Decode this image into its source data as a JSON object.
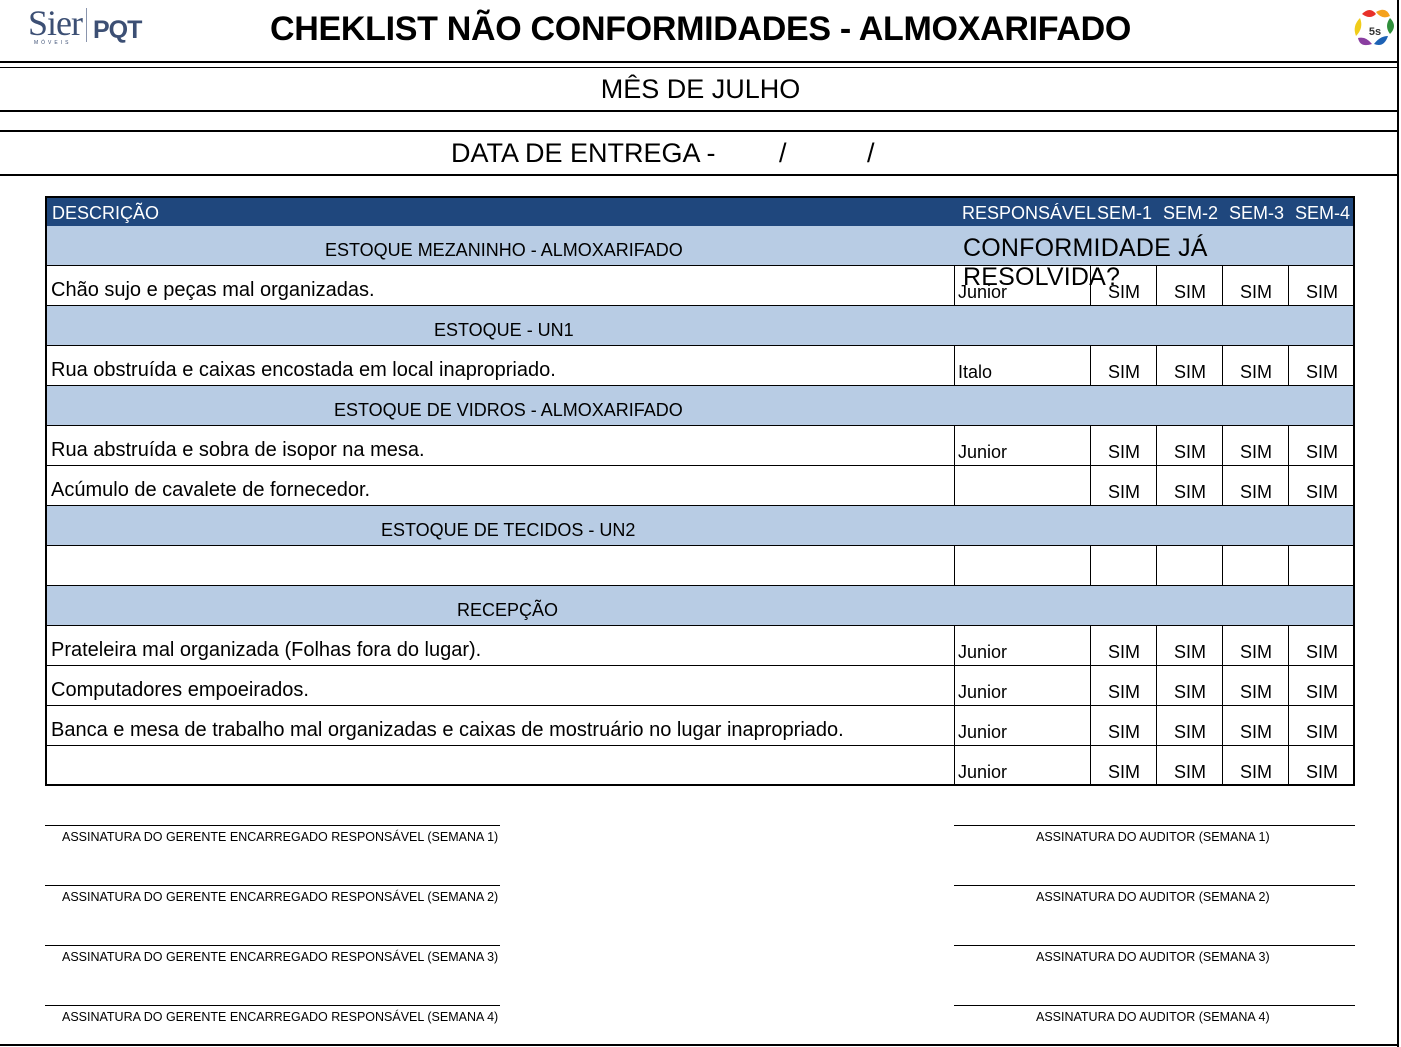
{
  "header": {
    "logo_left": "Sier",
    "logo_left_sub": "MÓVEIS",
    "logo_middle": "PQT",
    "title": "CHEKLIST NÃO CONFORMIDADES - ALMOXARIFADO",
    "logo_right": "5s"
  },
  "month": "MÊS DE JULHO",
  "delivery": {
    "label": "DATA DE ENTREGA -",
    "slash": "/"
  },
  "table": {
    "columns": {
      "description": "DESCRIÇÃO",
      "responsible": "RESPONSÁVEL",
      "week1": "SEM-1",
      "week2": "SEM-2",
      "week3": "SEM-3",
      "week4": "SEM-4"
    },
    "question": "CONFORMIDADE JÁ RESOLVIDA?",
    "sections": [
      {
        "title": "ESTOQUE MEZANINHO - ALMOXARIFADO"
      },
      {
        "title": "ESTOQUE - UN1"
      },
      {
        "title": "ESTOQUE DE VIDROS - ALMOXARIFADO"
      },
      {
        "title": "ESTOQUE DE TECIDOS - UN2"
      },
      {
        "title": "RECEPÇÃO"
      }
    ],
    "rows": [
      {
        "description": "Chão sujo e peças mal organizadas.",
        "responsible": "Junior",
        "weeks": [
          "SIM",
          "SIM",
          "SIM",
          "SIM"
        ]
      },
      {
        "description": "Rua obstruída e caixas encostada em local inapropriado.",
        "responsible": "Italo",
        "weeks": [
          "SIM",
          "SIM",
          "SIM",
          "SIM"
        ]
      },
      {
        "description": "Rua abstruída e sobra de isopor na mesa.",
        "responsible": "Junior",
        "weeks": [
          "SIM",
          "SIM",
          "SIM",
          "SIM"
        ]
      },
      {
        "description": "Acúmulo de cavalete de fornecedor.",
        "responsible": "",
        "weeks": [
          "SIM",
          "SIM",
          "SIM",
          "SIM"
        ]
      },
      {
        "description": "",
        "responsible": "",
        "weeks": [
          "",
          "",
          "",
          ""
        ]
      },
      {
        "description": "Prateleira mal organizada (Folhas fora do lugar).",
        "responsible": "Junior",
        "weeks": [
          "SIM",
          "SIM",
          "SIM",
          "SIM"
        ]
      },
      {
        "description": "Computadores empoeirados.",
        "responsible": "Junior",
        "weeks": [
          "SIM",
          "SIM",
          "SIM",
          "SIM"
        ]
      },
      {
        "description": "Banca e mesa de trabalho mal organizadas e caixas de mostruário no lugar inapropriado.",
        "responsible": "Junior",
        "weeks": [
          "SIM",
          "SIM",
          "SIM",
          "SIM"
        ]
      },
      {
        "description": "",
        "responsible": "Junior",
        "weeks": [
          "SIM",
          "SIM",
          "SIM",
          "SIM"
        ]
      }
    ]
  },
  "signatures": {
    "manager": [
      "ASSINATURA DO GERENTE ENCARREGADO RESPONSÁVEL (SEMANA 1)",
      "ASSINATURA DO GERENTE ENCARREGADO RESPONSÁVEL (SEMANA 2)",
      "ASSINATURA DO GERENTE ENCARREGADO RESPONSÁVEL (SEMANA 3)",
      "ASSINATURA DO GERENTE ENCARREGADO RESPONSÁVEL (SEMANA 4)"
    ],
    "auditor": [
      "ASSINATURA DO AUDITOR (SEMANA 1)",
      "ASSINATURA DO AUDITOR (SEMANA 2)",
      "ASSINATURA DO AUDITOR (SEMANA 3)",
      "ASSINATURA DO AUDITOR (SEMANA 4)"
    ]
  },
  "colors": {
    "header_bg": "#1f477d",
    "section_bg": "#b8cce4",
    "logo_blue": "#3c4f74"
  }
}
